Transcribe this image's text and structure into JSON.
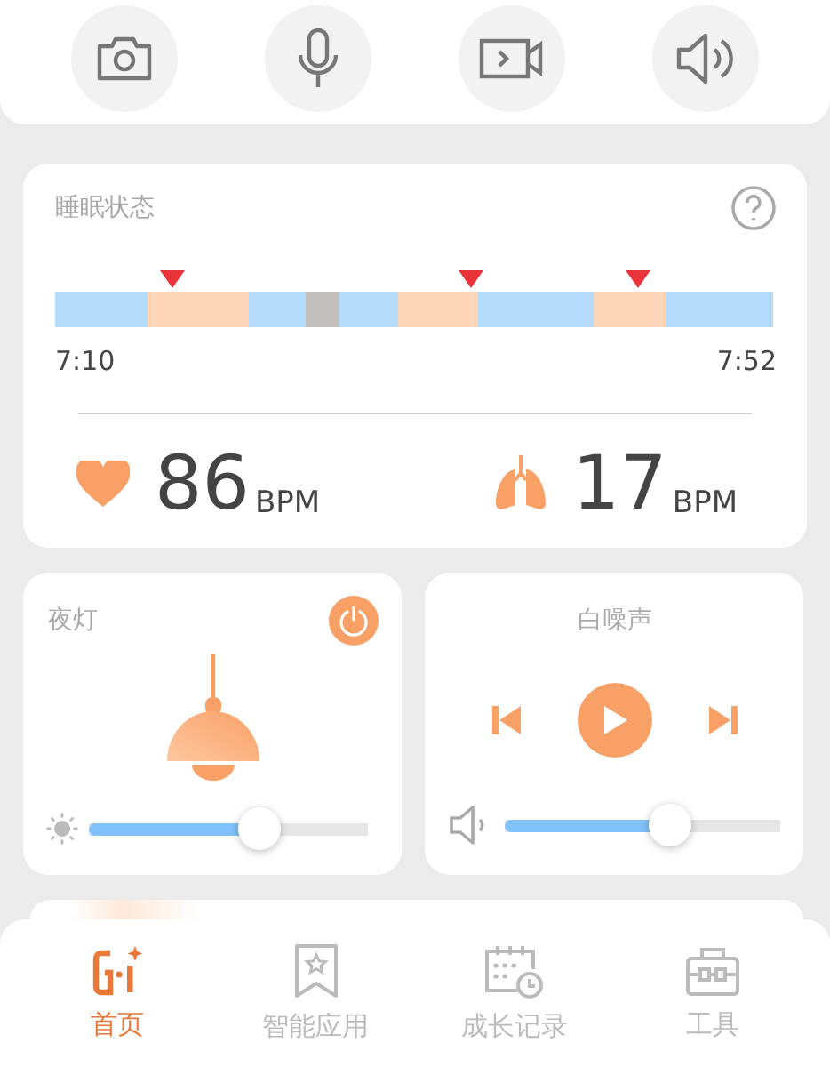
{
  "quick_actions": [
    {
      "kind": "camera"
    },
    {
      "kind": "microphone"
    },
    {
      "kind": "video"
    },
    {
      "kind": "speaker"
    }
  ],
  "sleep": {
    "title": "睡眠状态",
    "start_time": "7:10",
    "end_time": "7:52",
    "vitals": [
      {
        "kind": "heart",
        "value": "86",
        "unit": "BPM"
      },
      {
        "kind": "lungs",
        "value": "17",
        "unit": "BPM"
      }
    ]
  },
  "night_light": {
    "title": "夜灯",
    "on": true,
    "brightness": {
      "level": 0.61
    }
  },
  "white_noise": {
    "title": "白噪声",
    "playing": false,
    "volume": {
      "level": 0.6
    }
  },
  "tabs": [
    {
      "label": "首页",
      "kind": "home",
      "selected": true
    },
    {
      "label": "智能应用",
      "kind": "bookmark",
      "selected": false
    },
    {
      "label": "成长记录",
      "kind": "calendar",
      "selected": false
    },
    {
      "label": "工具",
      "kind": "toolbox",
      "selected": false
    }
  ]
}
